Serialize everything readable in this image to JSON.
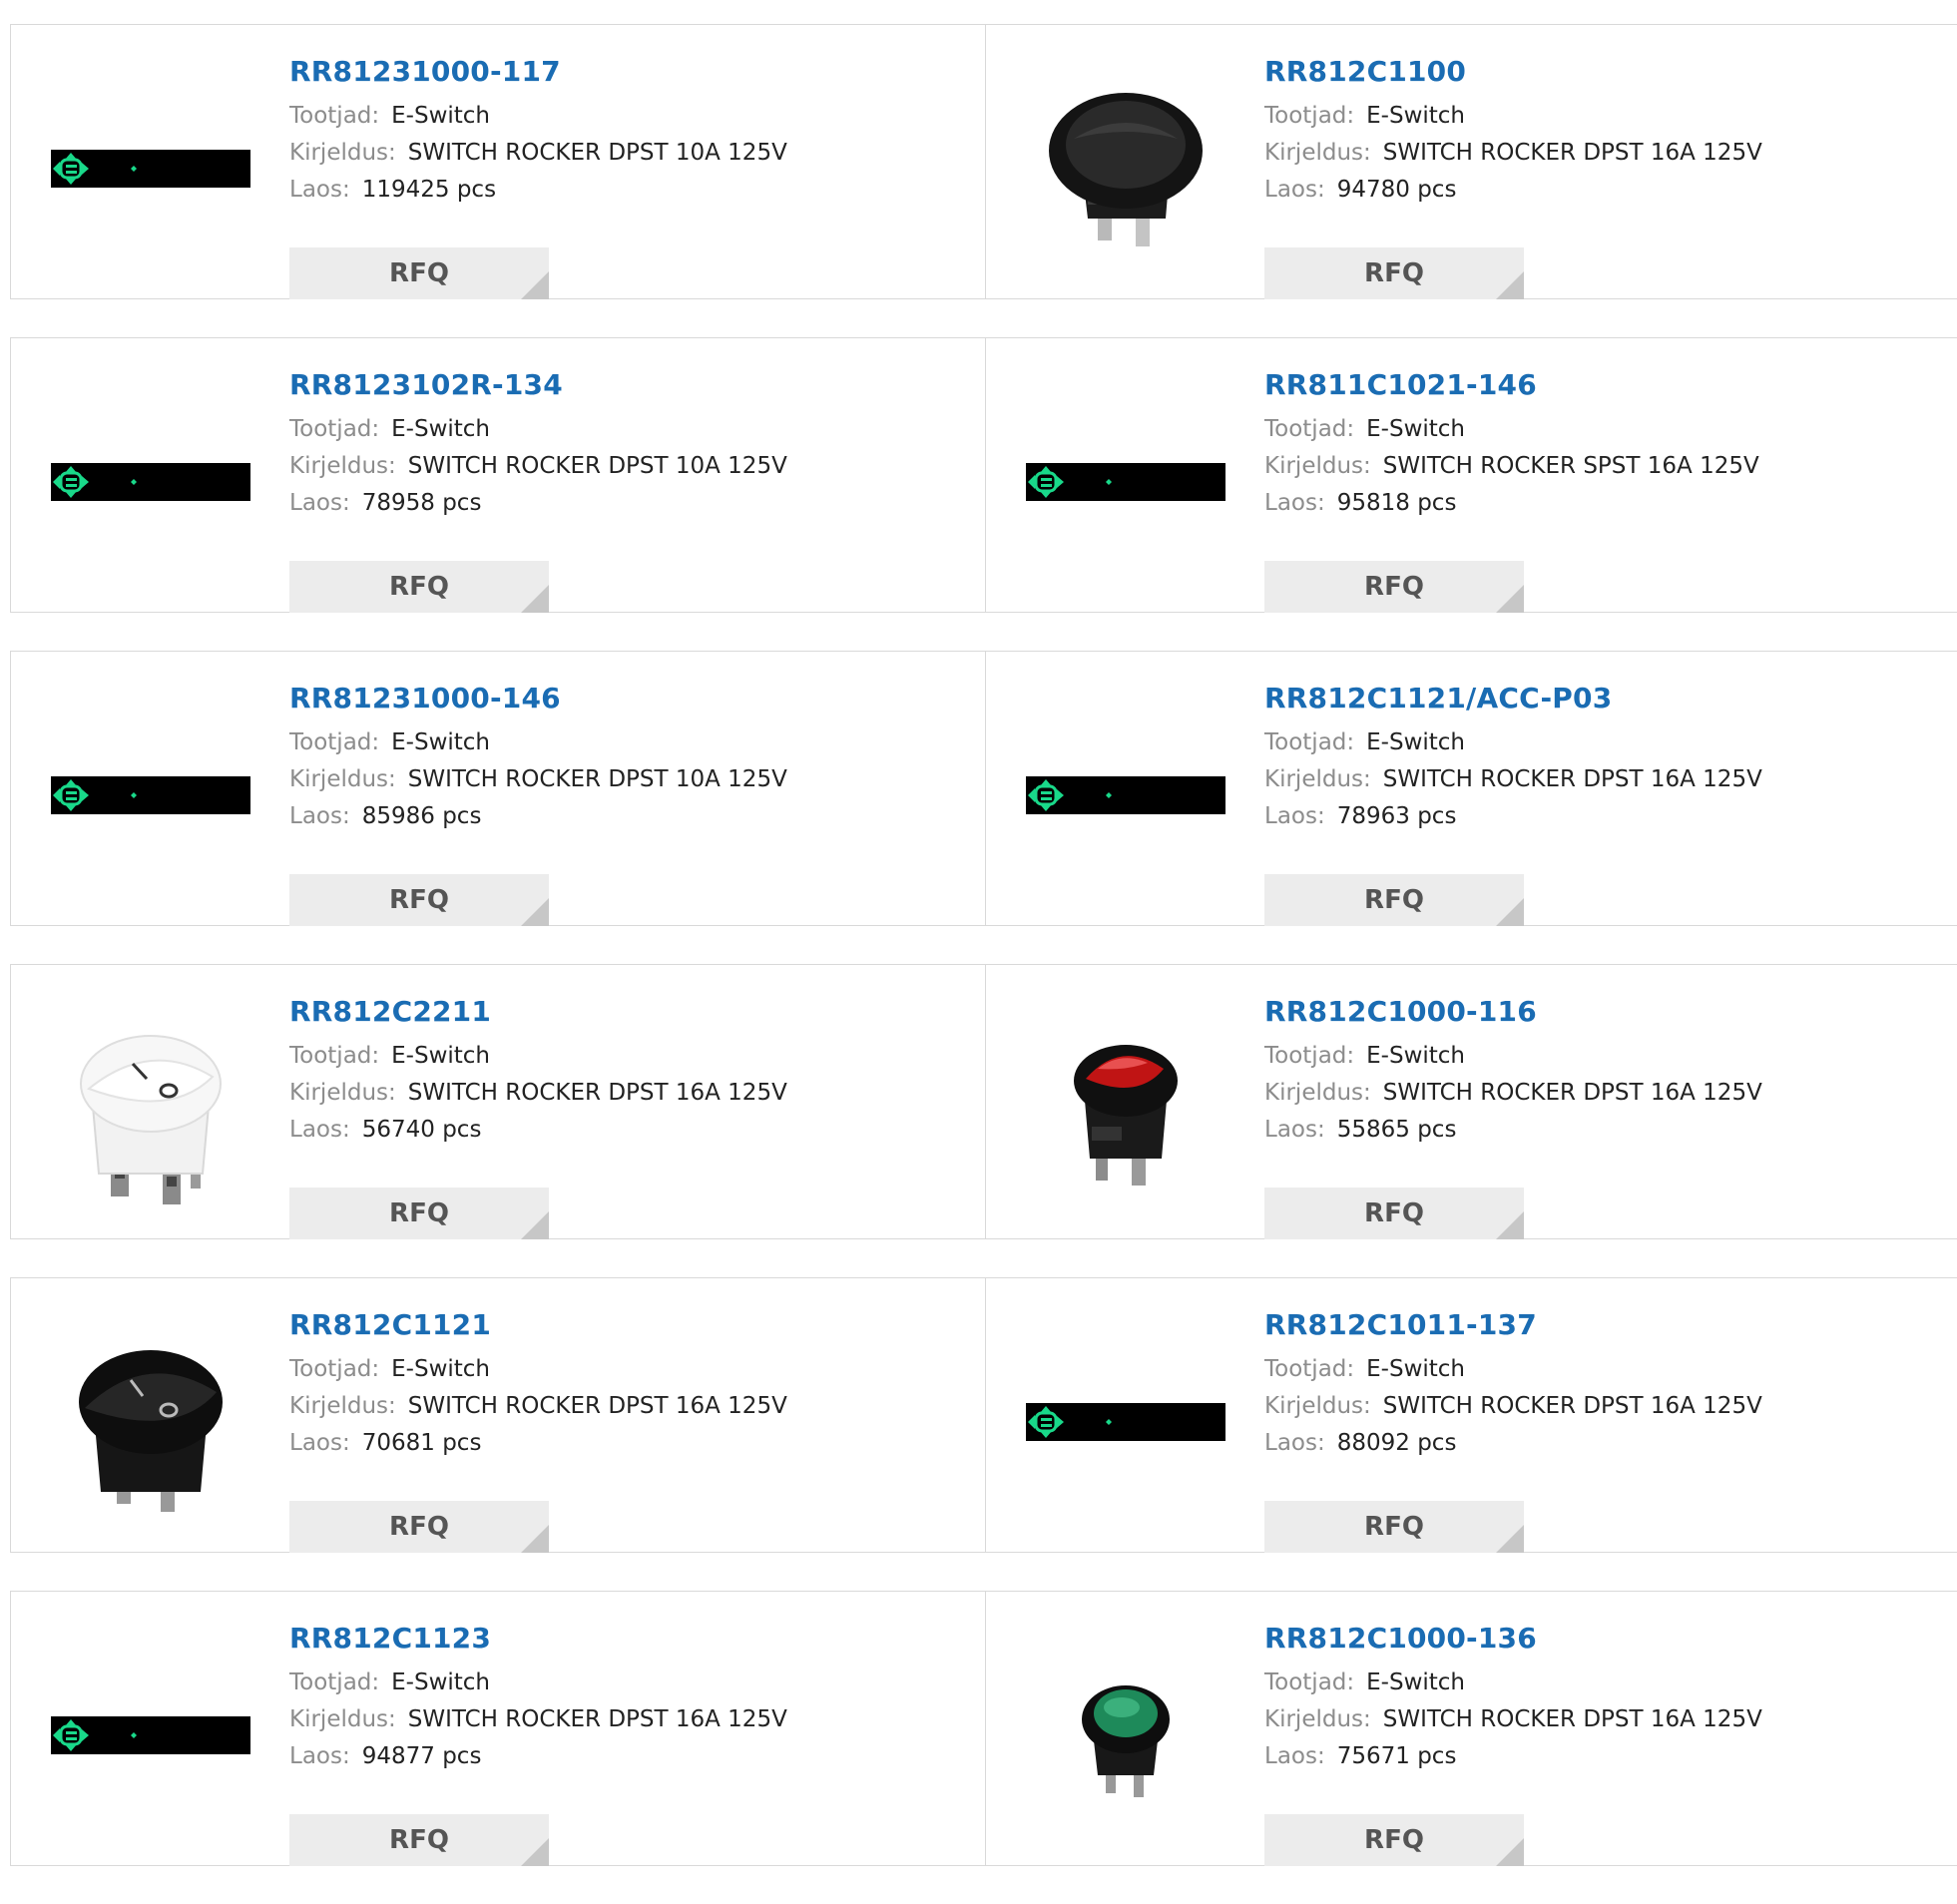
{
  "labels": {
    "manufacturer": "Tootjad:",
    "description": "Kirjeldus:",
    "stock": "Laos:",
    "rfq": "RFQ"
  },
  "products": [
    {
      "part": "RR81231000-117",
      "manufacturer": "E-Switch",
      "description": "SWITCH ROCKER DPST 10A 125V",
      "stock": "119425 pcs",
      "image": "placeholder-icon"
    },
    {
      "part": "RR812C1100",
      "manufacturer": "E-Switch",
      "description": "SWITCH ROCKER DPST 16A 125V",
      "stock": "94780 pcs",
      "image": "black-rocker-switch-side-icon"
    },
    {
      "part": "RR8123102R-134",
      "manufacturer": "E-Switch",
      "description": "SWITCH ROCKER DPST 10A 125V",
      "stock": "78958 pcs",
      "image": "placeholder-icon"
    },
    {
      "part": "RR811C1021-146",
      "manufacturer": "E-Switch",
      "description": "SWITCH ROCKER SPST 16A 125V",
      "stock": "95818 pcs",
      "image": "placeholder-icon"
    },
    {
      "part": "RR81231000-146",
      "manufacturer": "E-Switch",
      "description": "SWITCH ROCKER DPST 10A 125V",
      "stock": "85986 pcs",
      "image": "placeholder-icon"
    },
    {
      "part": "RR812C1121/ACC-P03",
      "manufacturer": "E-Switch",
      "description": "SWITCH ROCKER DPST 16A 125V",
      "stock": "78963 pcs",
      "image": "placeholder-icon"
    },
    {
      "part": "RR812C2211",
      "manufacturer": "E-Switch",
      "description": "SWITCH ROCKER DPST 16A 125V",
      "stock": "56740 pcs",
      "image": "white-rocker-switch-icon"
    },
    {
      "part": "RR812C1000-116",
      "manufacturer": "E-Switch",
      "description": "SWITCH ROCKER DPST 16A 125V",
      "stock": "55865 pcs",
      "image": "red-rocker-switch-icon"
    },
    {
      "part": "RR812C1121",
      "manufacturer": "E-Switch",
      "description": "SWITCH ROCKER DPST 16A 125V",
      "stock": "70681 pcs",
      "image": "black-rocker-switch-icon"
    },
    {
      "part": "RR812C1011-137",
      "manufacturer": "E-Switch",
      "description": "SWITCH ROCKER DPST 16A 125V",
      "stock": "88092 pcs",
      "image": "placeholder-icon"
    },
    {
      "part": "RR812C1123",
      "manufacturer": "E-Switch",
      "description": "SWITCH ROCKER DPST 16A 125V",
      "stock": "94877 pcs",
      "image": "placeholder-icon"
    },
    {
      "part": "RR812C1000-136",
      "manufacturer": "E-Switch",
      "description": "SWITCH ROCKER DPST 16A 125V",
      "stock": "75671 pcs",
      "image": "green-rocker-switch-icon"
    }
  ],
  "colors": {
    "link": "#1a6cb3",
    "label": "#8c8c8c",
    "button_bg": "#ececec",
    "placeholder_green": "#19d98a"
  }
}
